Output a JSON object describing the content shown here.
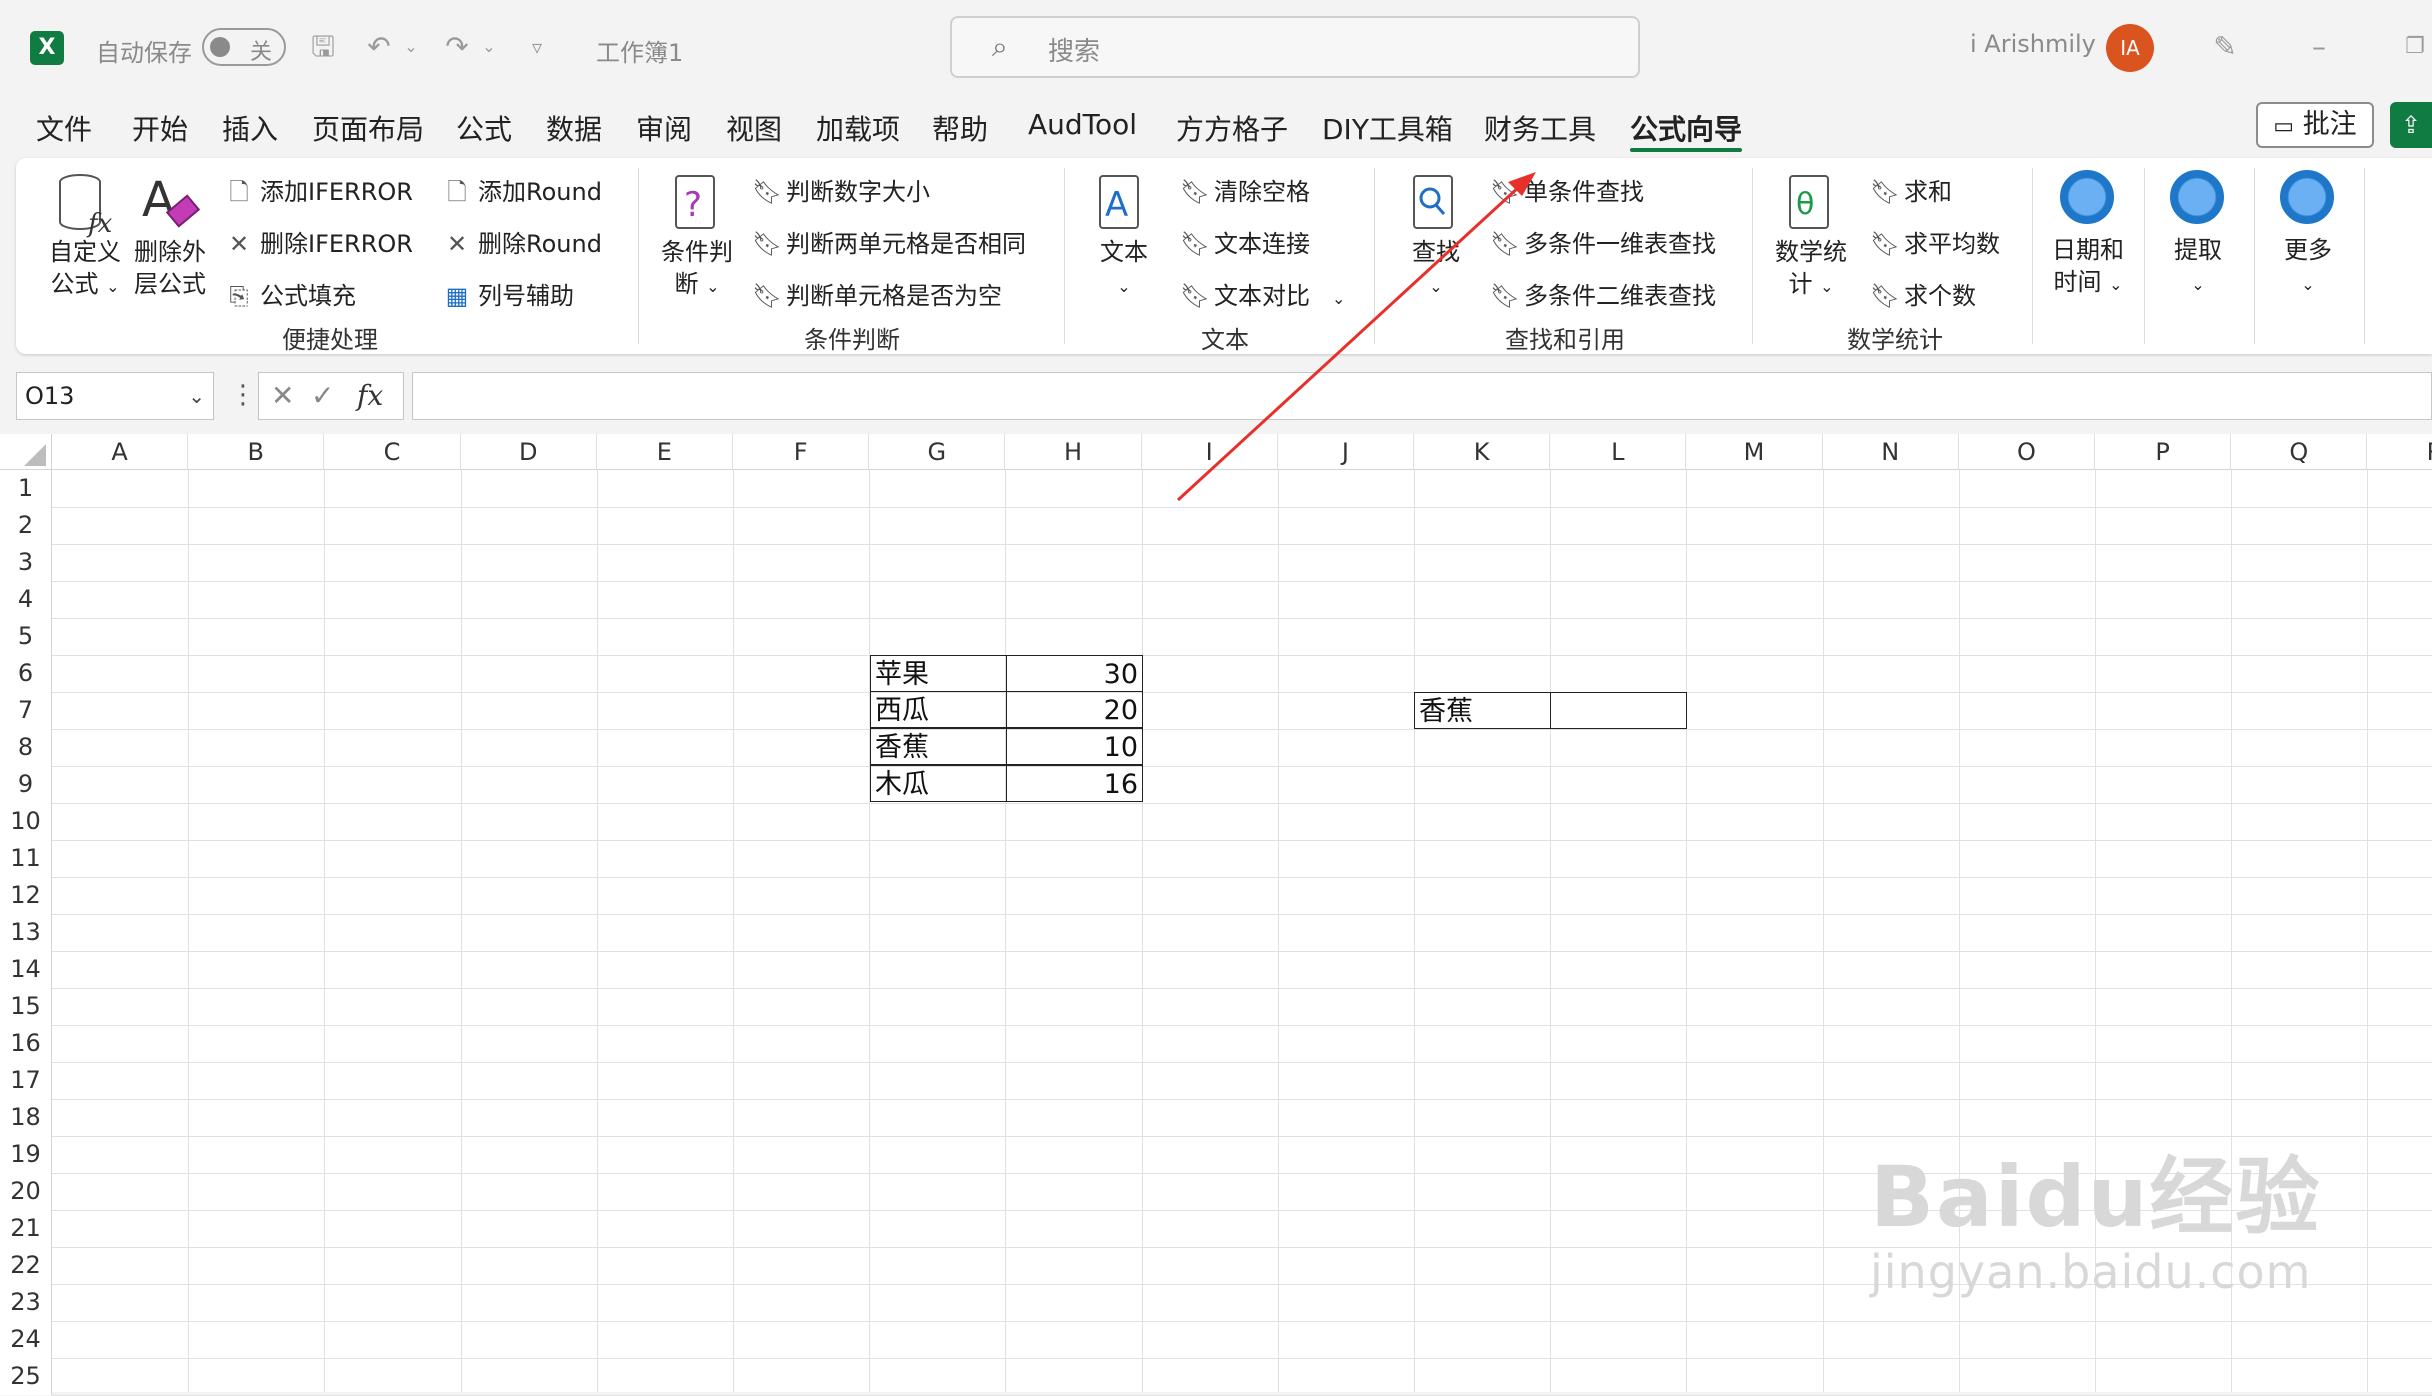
{
  "titlebar": {
    "app_icon": "excel-icon",
    "autosave_label": "自动保存",
    "autosave_toggle": "关",
    "workbook_name": "工作簿1",
    "search_placeholder": "搜索",
    "user_name": "i Arishmily",
    "avatar_initials": "IA"
  },
  "menu": {
    "items": [
      "文件",
      "开始",
      "插入",
      "页面布局",
      "公式",
      "数据",
      "审阅",
      "视图",
      "加载项",
      "帮助",
      "AudTool",
      "方方格子",
      "DIY工具箱",
      "财务工具",
      "公式向导"
    ],
    "active": "公式向导",
    "comment_button": "批注"
  },
  "ribbon": {
    "groups": [
      {
        "label": "便捷处理",
        "big": [
          {
            "label": "自定义\n公式",
            "icon": "custom-formula-icon"
          },
          {
            "label": "删除外\n层公式",
            "icon": "eraser-icon"
          }
        ],
        "small": [
          "添加IFERROR",
          "删除IFERROR",
          "公式填充",
          "添加Round",
          "删除Round",
          "列号辅助"
        ]
      },
      {
        "label": "条件判断",
        "big": [
          {
            "label": "条件判\n断",
            "icon": "question-icon"
          }
        ],
        "small": [
          "判断数字大小",
          "判断两单元格是否相同",
          "判断单元格是否为空"
        ]
      },
      {
        "label": "文本",
        "big": [
          {
            "label": "文本",
            "icon": "text-icon"
          }
        ],
        "small": [
          "清除空格",
          "文本连接",
          "文本对比"
        ]
      },
      {
        "label": "查找和引用",
        "big": [
          {
            "label": "查找",
            "icon": "lookup-icon"
          }
        ],
        "small": [
          "单条件查找",
          "多条件一维表查找",
          "多条件二维表查找"
        ]
      },
      {
        "label": "数学统计",
        "big": [
          {
            "label": "数学统\n计",
            "icon": "theta-icon"
          }
        ],
        "small": [
          "求和",
          "求平均数",
          "求个数"
        ]
      },
      {
        "label": "",
        "big": [
          {
            "label": "日期和\n时间",
            "icon": "circle-icon"
          },
          {
            "label": "提取",
            "icon": "circle-icon"
          },
          {
            "label": "更多",
            "icon": "circle-icon"
          }
        ]
      }
    ]
  },
  "formula_bar": {
    "name_box": "O13",
    "fx_label": "fx",
    "content": ""
  },
  "sheet": {
    "columns": [
      "A",
      "B",
      "C",
      "D",
      "E",
      "F",
      "G",
      "H",
      "I",
      "J",
      "K",
      "L",
      "M",
      "N",
      "O",
      "P",
      "Q",
      "R"
    ],
    "rows": [
      "1",
      "2",
      "3",
      "4",
      "5",
      "6",
      "7",
      "8",
      "9",
      "10",
      "11",
      "12",
      "13",
      "14",
      "15",
      "16",
      "17",
      "18",
      "19",
      "20",
      "21",
      "22",
      "23",
      "24",
      "25"
    ],
    "table": [
      {
        "name": "苹果",
        "value": "30"
      },
      {
        "name": "西瓜",
        "value": "20"
      },
      {
        "name": "香蕉",
        "value": "10"
      },
      {
        "name": "木瓜",
        "value": "16"
      }
    ],
    "lookup": {
      "key": "香蕉",
      "result": ""
    }
  },
  "annotation": {
    "color": "#e8302a",
    "target": "单条件查找"
  },
  "watermark": {
    "brand": "Baidu经验",
    "url": "jingyan.baidu.com"
  }
}
